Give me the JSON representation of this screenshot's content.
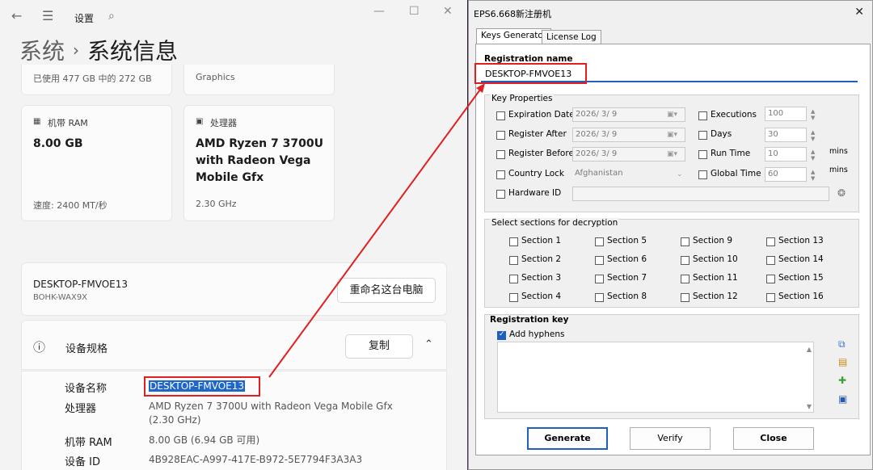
{
  "settings": {
    "title": "设置",
    "breadcrumb": {
      "parent": "系统",
      "separator": "›",
      "current": "系统信息"
    },
    "storage_text": "已使用 477 GB 中的 272 GB",
    "graphics_text": "Graphics",
    "ram_card": {
      "label": "机带 RAM",
      "value": "8.00 GB",
      "sub": "速度: 2400 MT/秒"
    },
    "cpu_card": {
      "label": "处理器",
      "value_lines": [
        "AMD Ryzen 7 3700U",
        "with Radeon Vega",
        "Mobile Gfx"
      ],
      "sub": "2.30 GHz"
    },
    "device": {
      "name": "DESKTOP-FMVOE13",
      "model": "BOHK-WAX9X",
      "rename_button": "重命名这台电脑"
    },
    "specs": {
      "title": "设备规格",
      "copy_button": "复制",
      "rows": [
        {
          "label": "设备名称",
          "value": "DESKTOP-FMVOE13"
        },
        {
          "label": "处理器",
          "value_lines": [
            "AMD Ryzen 7 3700U with Radeon Vega Mobile Gfx",
            "(2.30 GHz)"
          ]
        },
        {
          "label": "机带 RAM",
          "value": "8.00 GB (6.94 GB 可用)"
        },
        {
          "label": "设备 ID",
          "value": "4B928EAC-A997-417E-B972-5E7794F3A3A3"
        }
      ]
    }
  },
  "keygen": {
    "title": "EPS6.668新注册机",
    "tabs": [
      "Keys Generator",
      "License Log"
    ],
    "registration_name_label": "Registration name",
    "registration_name_value": "DESKTOP-FMVOE13",
    "key_properties": {
      "title": "Key Properties",
      "left": [
        {
          "label": "Expiration Date",
          "value": "2026/ 3/ 9"
        },
        {
          "label": "Register After",
          "value": "2026/ 3/ 9"
        },
        {
          "label": "Register Before",
          "value": "2026/ 3/ 9"
        },
        {
          "label": "Country Lock",
          "value": "Afghanistan"
        },
        {
          "label": "Hardware ID",
          "value": ""
        }
      ],
      "right": [
        {
          "label": "Executions",
          "value": "100",
          "unit": ""
        },
        {
          "label": "Days",
          "value": "30",
          "unit": ""
        },
        {
          "label": "Run Time",
          "value": "10",
          "unit": "mins"
        },
        {
          "label": "Global Time",
          "value": "60",
          "unit": "mins"
        }
      ]
    },
    "sections": {
      "title": "Select sections for decryption",
      "items": [
        "Section 1",
        "Section 5",
        "Section 9",
        "Section 13",
        "Section 2",
        "Section 6",
        "Section 10",
        "Section 14",
        "Section 3",
        "Section 7",
        "Section 11",
        "Section 15",
        "Section 4",
        "Section 8",
        "Section 12",
        "Section 16"
      ]
    },
    "registration_key": {
      "title": "Registration key",
      "add_hyphens": "Add hyphens",
      "value": ""
    },
    "buttons": {
      "generate": "Generate",
      "verify": "Verify",
      "close": "Close"
    },
    "close_glyph": "✕"
  },
  "icons": {
    "back": "back-arrow-icon",
    "menu": "hamburger-menu-icon",
    "search": "search-icon",
    "ram": "memory-chip-icon",
    "cpu": "processor-icon",
    "info": "info-icon",
    "chevron": "chevron-up-icon",
    "fingerprint": "fingerprint-icon",
    "copy": "copy-icon",
    "paste": "paste-icon",
    "add": "add-icon",
    "save": "save-icon"
  },
  "colors": {
    "accent": "#1f5fbf",
    "highlight": "#1e66c8",
    "annotation": "#e02020"
  }
}
